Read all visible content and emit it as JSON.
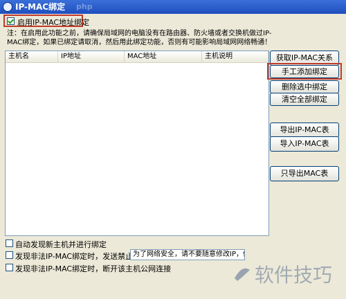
{
  "window": {
    "title": "IP-MAC绑定",
    "title_watermark": "php"
  },
  "enable_binding": {
    "label": "启用IP-MAC地址绑定",
    "checked": true
  },
  "notice": "注：在启用此功能之前，请确保局域网的电脑没有在路由器、防火墙或者交换机做过IP-MAC绑定，如果已绑定请取消，然后用此绑定功能，否则有可能影响局域网网络畅通！",
  "table": {
    "columns": [
      "主机名",
      "IP地址",
      "MAC地址",
      "主机说明"
    ],
    "rows": []
  },
  "buttons": {
    "get_relation": "获取IP-MAC关系",
    "manual_add": "手工添加绑定",
    "delete_selected": "删除选中绑定",
    "clear_all": "清空全部绑定",
    "export_table": "导出IP-MAC表",
    "import_table": "导入IP-MAC表",
    "export_mac_only": "只导出MAC表"
  },
  "options": {
    "auto_bind": {
      "label": "自动发现新主机并进行绑定",
      "checked": false
    },
    "send_block_msg": {
      "label": "发现非法IP-MAC绑定时，发送禁止消息",
      "checked": false
    },
    "block_message": "为了网络安全，请不要随意修改IP，你的",
    "disconnect_host": {
      "label": "发现非法IP-MAC绑定时，断开该主机公网连接",
      "checked": false
    }
  },
  "watermark": "软件技巧",
  "colors": {
    "titlebar": "#1f4fbf",
    "highlight": "#c0392b",
    "dialog_bg": "#ece9d8"
  }
}
